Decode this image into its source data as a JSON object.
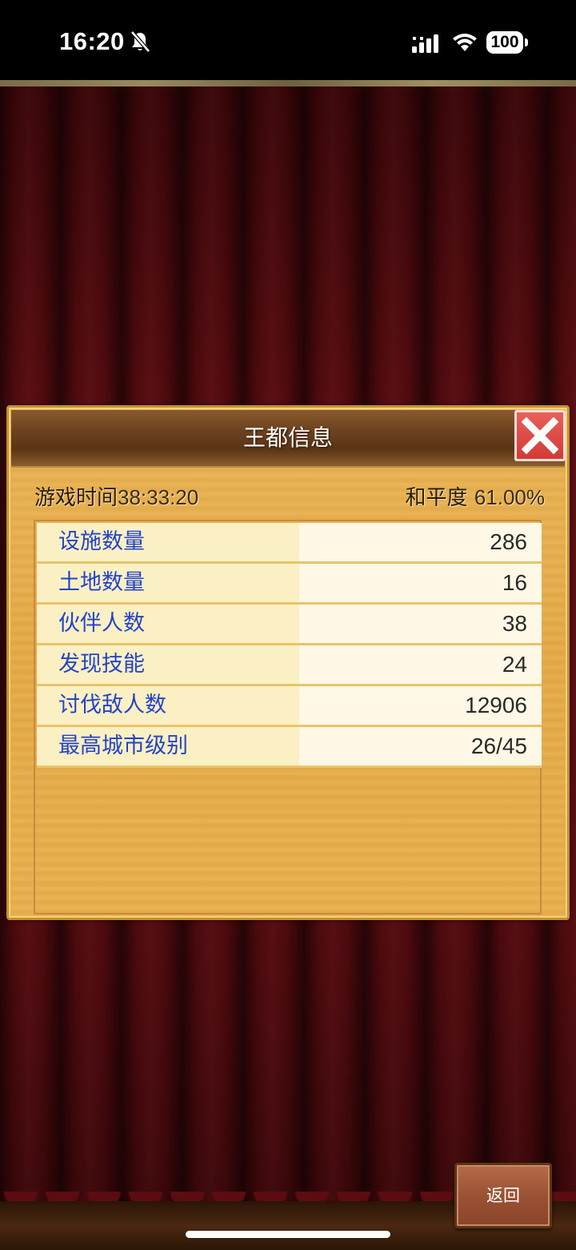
{
  "status_bar": {
    "time": "16:20",
    "battery": "100",
    "icons": [
      "mute-bell-icon",
      "signal-icon",
      "wifi-icon",
      "battery-icon"
    ]
  },
  "panel": {
    "title": "王都信息",
    "close_icon": "close-icon",
    "playtime_label": "游戏时间",
    "playtime_value": "38:33:20",
    "peace_label": "和平度",
    "peace_value": "61.00%"
  },
  "stats": [
    {
      "label": "设施数量",
      "value": "286"
    },
    {
      "label": "土地数量",
      "value": "16"
    },
    {
      "label": "伙伴人数",
      "value": "38"
    },
    {
      "label": "发现技能",
      "value": "24"
    },
    {
      "label": "讨伐敌人数",
      "value": "12906"
    },
    {
      "label": "最高城市级别",
      "value": "26/45"
    }
  ],
  "back_button": "返回",
  "colors": {
    "curtain": "#5a0c10",
    "panel": "#e6aa46",
    "header": "#6e4320",
    "stat_label": "#2443c8",
    "close": "#d43a36",
    "back_button": "#9a5234"
  }
}
